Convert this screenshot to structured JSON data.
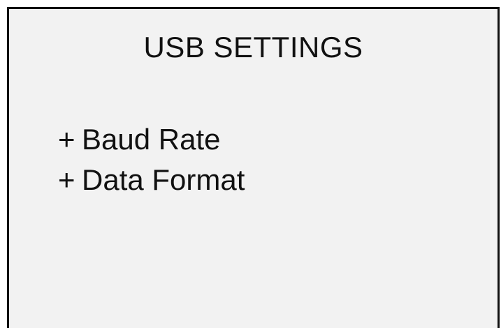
{
  "screen": {
    "title": "USB SETTINGS",
    "menu": {
      "items": [
        {
          "prefix": "+",
          "label": "Baud Rate"
        },
        {
          "prefix": "+",
          "label": "Data Format"
        }
      ]
    }
  },
  "colors": {
    "screen_background": "#f2f2f2",
    "border": "#111111",
    "text": "#111111"
  }
}
